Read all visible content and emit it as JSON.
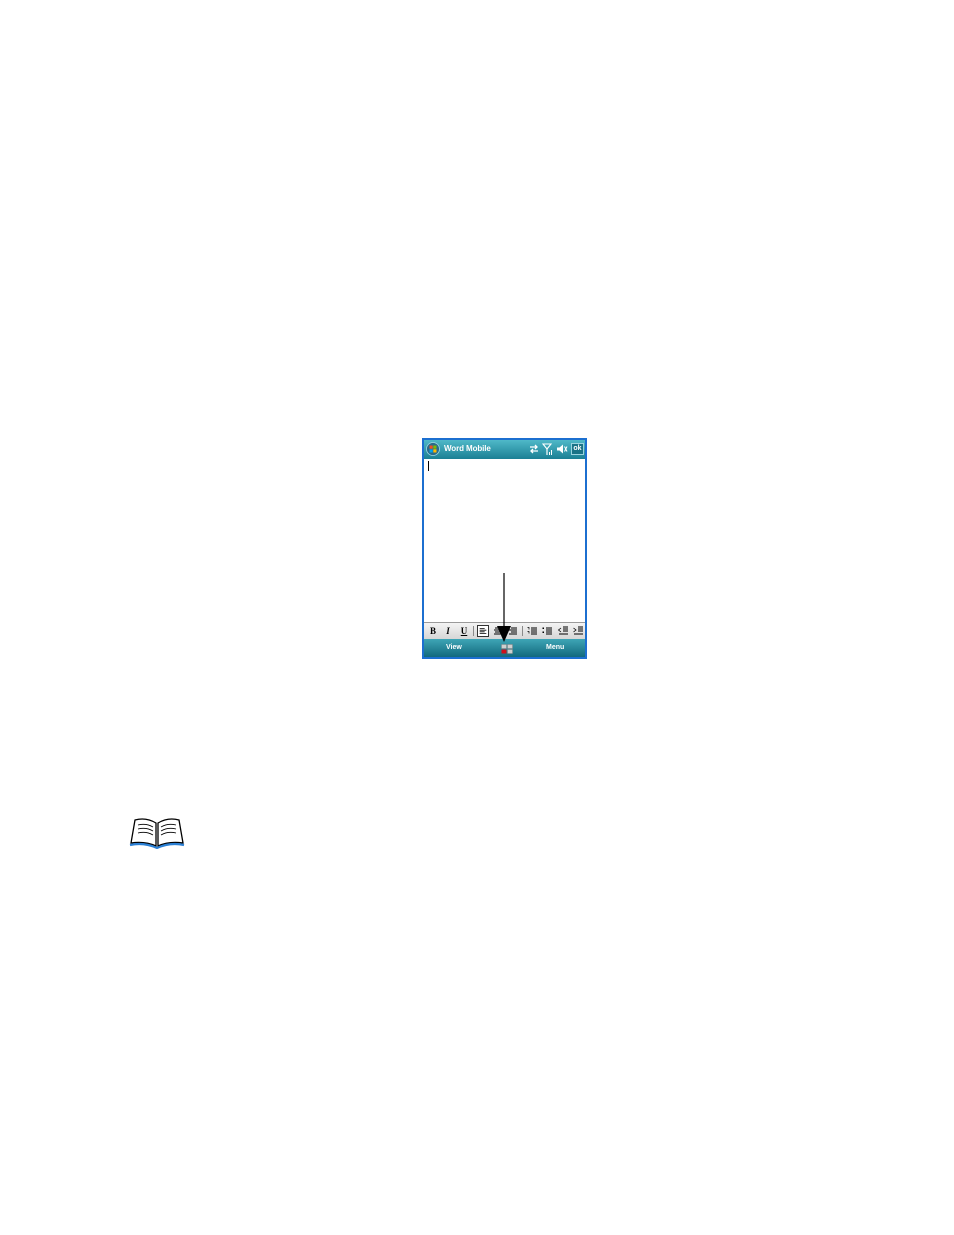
{
  "window": {
    "title": "Word Mobile",
    "ok_label": "ok"
  },
  "tray_icons": [
    "connectivity-icon",
    "signal-icon",
    "speaker-muted-icon"
  ],
  "toolbar": {
    "bold_label": "B",
    "italic_label": "I",
    "underline_label": "U"
  },
  "softkeys": {
    "left_label": "View",
    "right_label": "Menu"
  },
  "colors": {
    "title_bar": "#1b7f94",
    "device_border": "#1c6fd0",
    "softkey_bar": "#12697d"
  }
}
